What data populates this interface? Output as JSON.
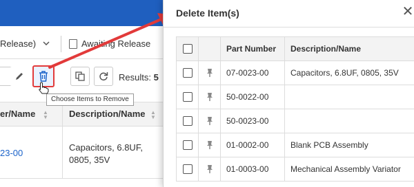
{
  "toolbar": {
    "release_dropdown": "Release)",
    "awaiting_release": "Awaiting Release",
    "results_label": "Results:",
    "results_count": "5"
  },
  "tooltip": {
    "text": "Choose Items to Remove"
  },
  "grid": {
    "columns": [
      "er/Name",
      "Description/Name"
    ],
    "row": {
      "part": "23-00",
      "description": "Capacitors, 6.8UF, 0805, 35V"
    }
  },
  "modal": {
    "title": "Delete Item(s)",
    "columns": {
      "part_number": "Part Number",
      "description": "Description/Name"
    },
    "rows": [
      {
        "part_number": "07-0023-00",
        "description": "Capacitors, 6.8UF, 0805, 35V"
      },
      {
        "part_number": "50-0022-00",
        "description": ""
      },
      {
        "part_number": "50-0023-00",
        "description": ""
      },
      {
        "part_number": "01-0002-00",
        "description": "Blank PCB Assembly"
      },
      {
        "part_number": "01-0003-00",
        "description": "Mechanical Assembly Variator"
      }
    ]
  },
  "colors": {
    "accent": "#1f5fbf",
    "highlight": "#e23a3a",
    "link": "#1a62c9"
  },
  "icons": [
    "pencil-icon",
    "trash-icon",
    "copy-icon",
    "refresh-icon",
    "document-icon",
    "chevron-down-icon",
    "sort-icon",
    "pushpin-icon",
    "close-icon",
    "cursor-hand-icon"
  ]
}
